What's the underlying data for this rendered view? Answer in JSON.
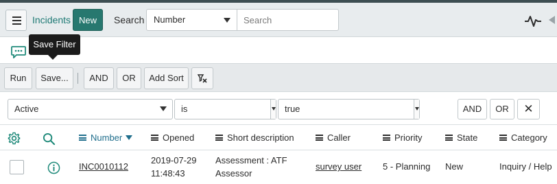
{
  "header": {
    "title": "Incidents",
    "new_label": "New",
    "search_label": "Search",
    "search_field_selected": "Number",
    "search_placeholder": "Search"
  },
  "tooltip": {
    "text": "Save Filter"
  },
  "toolbar": {
    "run": "Run",
    "save": "Save...",
    "and": "AND",
    "or": "OR",
    "add_sort": "Add Sort"
  },
  "condition": {
    "field": "Active",
    "operator": "is",
    "value": "true",
    "and": "AND",
    "or": "OR",
    "remove": "✕"
  },
  "table": {
    "columns": [
      "Number",
      "Opened",
      "Short description",
      "Caller",
      "Priority",
      "State",
      "Category"
    ],
    "sorted_column": "Number",
    "rows": [
      {
        "number": "INC0010112",
        "opened_date": "2019-07-29",
        "opened_time": "11:48:43",
        "short_description_1": "Assessment : ATF",
        "short_description_2": "Assessor",
        "caller": "survey user",
        "priority": "5 - Planning",
        "state": "New",
        "category": "Inquiry / Help"
      }
    ]
  },
  "colors": {
    "accent": "#27786f",
    "title": "#1f7a75",
    "sorted_header": "#1f6e8c",
    "icon_teal": "#1f8a7a"
  }
}
